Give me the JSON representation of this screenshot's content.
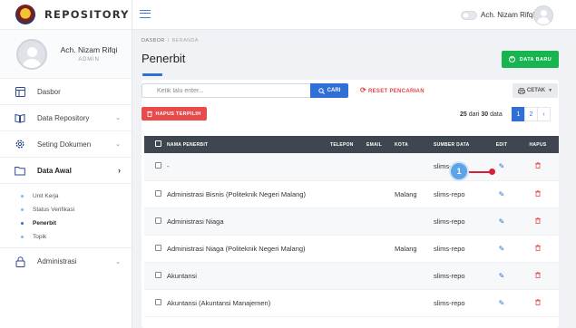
{
  "brand": {
    "name": "REPOSITORY"
  },
  "profile": {
    "name": "Ach. Nizam Rifqi",
    "role": "ADMIN"
  },
  "sidebar": {
    "items": [
      {
        "label": "Dasbor",
        "icon": "layout-icon"
      },
      {
        "label": "Data Repository",
        "icon": "book-icon",
        "chevron": "⌄"
      },
      {
        "label": "Seting Dokumen",
        "icon": "gear-icon",
        "chevron": "⌄"
      },
      {
        "label": "Data Awal",
        "icon": "folder-icon",
        "chevron": "›"
      },
      {
        "label": "Administrasi",
        "icon": "lock-icon",
        "chevron": "⌄"
      }
    ],
    "subitems": [
      "Unit Kerja",
      "Status Verifikasi",
      "Penerbit",
      "Topik"
    ]
  },
  "topbar": {
    "user_name": "Ach. Nizam Rifqi"
  },
  "breadcrumb": {
    "home": "DASBOR",
    "sep": "/",
    "current": "BERANDA"
  },
  "page": {
    "title": "Penerbit",
    "new_button": "DATA BARU"
  },
  "search": {
    "placeholder": "Ketik lalu enter...",
    "button": "CARI"
  },
  "reset_label": "RESET PENCARIAN",
  "print_label": "CETAK",
  "delete_selected_label": "HAPUS TERPILIH",
  "count": {
    "shown": "25",
    "middle": "dari",
    "total": "30",
    "suffix": "data"
  },
  "pagination": [
    "1",
    "2",
    "›"
  ],
  "table": {
    "headers": [
      "NAMA PENERBIT",
      "TELEPON",
      "EMAIL",
      "KOTA",
      "SUMBER DATA",
      "EDIT",
      "HAPUS"
    ],
    "rows": [
      {
        "name": "-",
        "phone": "",
        "email": "",
        "city": "",
        "source": "slims-repo"
      },
      {
        "name": "Administrasi Bisnis (Politeknik Negeri Malang)",
        "phone": "",
        "email": "",
        "city": "Malang",
        "source": "slims-repo"
      },
      {
        "name": "Administrasi Niaga",
        "phone": "",
        "email": "",
        "city": "",
        "source": "slims-repo"
      },
      {
        "name": "Administrasi Niaga (Politeknik Negeri Malang)",
        "phone": "",
        "email": "",
        "city": "Malang",
        "source": "slims-repo"
      },
      {
        "name": "Akuntansi",
        "phone": "",
        "email": "",
        "city": "",
        "source": "slims-repo"
      },
      {
        "name": "Akuntansi (Akuntansi Manajemen)",
        "phone": "",
        "email": "",
        "city": "",
        "source": "slims-repo"
      }
    ]
  },
  "callout": {
    "number": "1"
  },
  "colors": {
    "primary": "#2f6fd6",
    "success": "#17b54f",
    "danger": "#e84b4b",
    "header": "#3f4650"
  }
}
